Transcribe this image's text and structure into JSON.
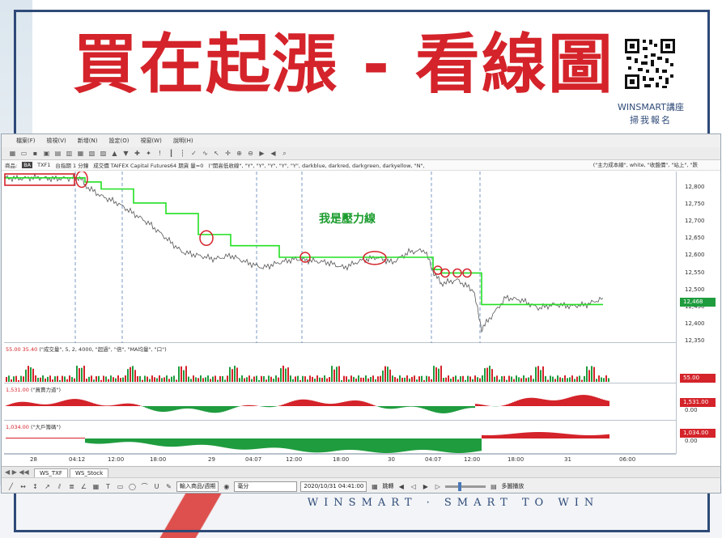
{
  "poster": {
    "title": "買在起漲 - 看線圖",
    "qr_caption_line1": "WINSMART講座",
    "qr_caption_line2": "掃我報名",
    "footer": "WINSMART · SMART TO WIN"
  },
  "menu": [
    "檔案(F)",
    "檢視(V)",
    "新增(N)",
    "設定(O)",
    "視窗(W)",
    "說明(H)"
  ],
  "infobar": {
    "prefix": "商品:",
    "symbol_badge": "BA",
    "symbol": "TXF1",
    "freq_label": "台指期 1 分鐘",
    "ticks_label": "成交價 TAIFEX Capital Futures64 期貨 量=0",
    "formula": "(\"開高低收線\", \"Y\", \"Y\", \"Y\", \"Y\", \"Y\", darkblue, darkred, darkgreen, darkyellow, \"N\",",
    "right_formula": "(\"主力成本線\", white, \"收盤價\", \"站上\", \"跌"
  },
  "annotation": "我是壓力線",
  "price_axis": {
    "labels": [
      "12,800",
      "12,750",
      "12,700",
      "12,650",
      "12,600",
      "12,550",
      "12,500",
      "12,450",
      "12,400",
      "12,350"
    ],
    "current_price": "12,468"
  },
  "volume_pane": {
    "header_values": "55.00  35.40",
    "header_formula": "(\"成交量\", 5, 2, 4000, \"超過\", \"倍\", \"MA均量\", \"口\")",
    "axis_tag": "55.00"
  },
  "buysell_pane": {
    "header_value": "1,531.00",
    "header_formula": "(\"買賣力道\")",
    "axis_tag": "1,531.00",
    "axis_zero": "0.00"
  },
  "bigplayer_pane": {
    "header_value": "1,034.00",
    "header_formula": "(\"大戶籌碼\")",
    "axis_tag": "1,034.00",
    "axis_zero": "0.00"
  },
  "time_axis": [
    "28",
    "04:12",
    "12:00",
    "18:00",
    "29",
    "04:07",
    "12:00",
    "18:00",
    "30",
    "04:07",
    "12:00",
    "18:00",
    "31",
    "06:00"
  ],
  "tabs": [
    "WS_TXF",
    "WS_Stock"
  ],
  "bottom_bar": {
    "symbol_input": "輸入商品/週期",
    "period_select": "毫分",
    "datetime": "2020/10/31 04:41:00",
    "jump_label": "跳轉",
    "multi_play": "多圖播放"
  },
  "chart_data": {
    "type": "line",
    "title": "",
    "xlabel": "",
    "ylabel": "",
    "ylim": [
      12340,
      12830
    ],
    "x": [
      0,
      20,
      40,
      60,
      80,
      95,
      100,
      120,
      140,
      160,
      180,
      200,
      220,
      240,
      260,
      280,
      300,
      320,
      340,
      360,
      380,
      400,
      420,
      440,
      460,
      480,
      500,
      520,
      530,
      540,
      560,
      580,
      590,
      600,
      620,
      640,
      660,
      680,
      700,
      720,
      740
    ],
    "series": [
      {
        "values": [
          12812,
          12810,
          12813,
          12809,
          12811,
          12812,
          12790,
          12760,
          12740,
          12710,
          12680,
          12640,
          12600,
          12590,
          12580,
          12590,
          12570,
          12555,
          12570,
          12580,
          12575,
          12570,
          12555,
          12575,
          12585,
          12570,
          12600,
          12605,
          12545,
          12510,
          12520,
          12490,
          12380,
          12410,
          12470,
          12462,
          12440,
          12450,
          12445,
          12450,
          12468
        ]
      },
      {
        "values": [
          12812,
          12812,
          12812,
          12812,
          12812,
          12812,
          12800,
          12780,
          12780,
          12740,
          12740,
          12710,
          12710,
          12650,
          12650,
          12618,
          12618,
          12618,
          12585,
          12585,
          12585,
          12585,
          12585,
          12585,
          12585,
          12585,
          12585,
          12585,
          12550,
          12540,
          12540,
          12540,
          12450,
          12450,
          12450,
          12450,
          12450,
          12450,
          12450,
          12450,
          12450
        ]
      }
    ]
  }
}
